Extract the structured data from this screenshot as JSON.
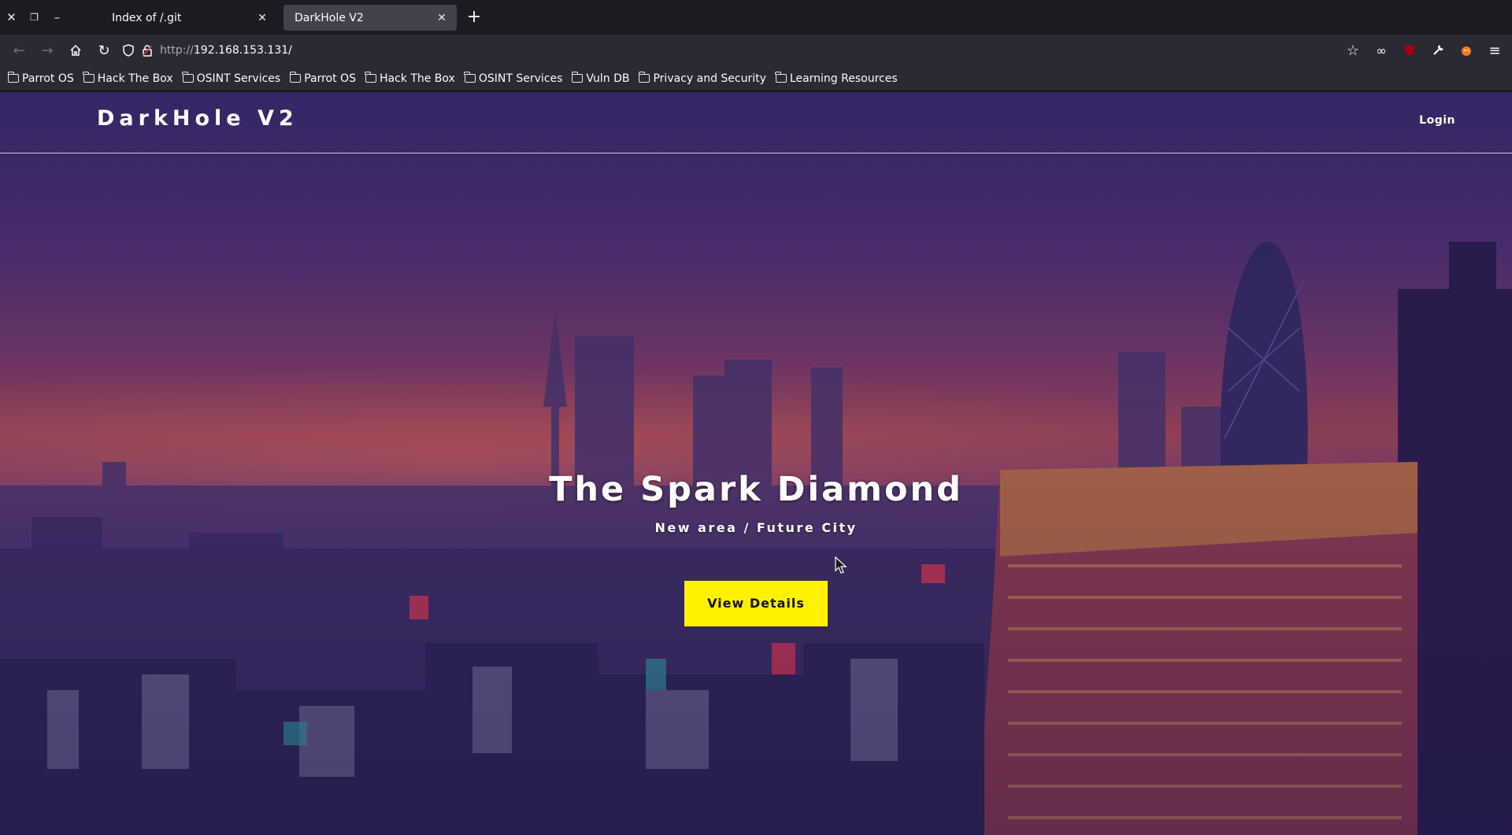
{
  "browser": {
    "tabs": [
      {
        "title": "Index of /.git",
        "active": false
      },
      {
        "title": "DarkHole V2",
        "active": true
      }
    ],
    "url": {
      "protocol": "http://",
      "host": "192.168.153.131/"
    },
    "bookmarks": [
      "Parrot OS",
      "Hack The Box",
      "OSINT Services",
      "Parrot OS",
      "Hack The Box",
      "OSINT Services",
      "Vuln DB",
      "Privacy and Security",
      "Learning Resources"
    ],
    "icons": {
      "close": "close-icon",
      "restore": "restore-icon",
      "minimize": "minimize-icon",
      "back": "back-arrow-icon",
      "forward": "forward-arrow-icon",
      "home": "home-icon",
      "reload": "reload-icon",
      "shield": "shield-icon",
      "lock": "insecure-lock-icon",
      "star": "bookmark-star-icon",
      "mask": "mask-icon",
      "ublock": "ublock-icon",
      "wrench": "wrench-icon",
      "fox": "foxyproxy-icon",
      "menu": "hamburger-menu-icon"
    }
  },
  "page": {
    "brand": "DarkHole V2",
    "nav_login": "Login",
    "hero": {
      "title": "The Spark Diamond",
      "subtitle": "New area / Future City",
      "button": "View Details"
    },
    "colors": {
      "button_bg": "#fff200",
      "text": "#ffffff"
    }
  }
}
